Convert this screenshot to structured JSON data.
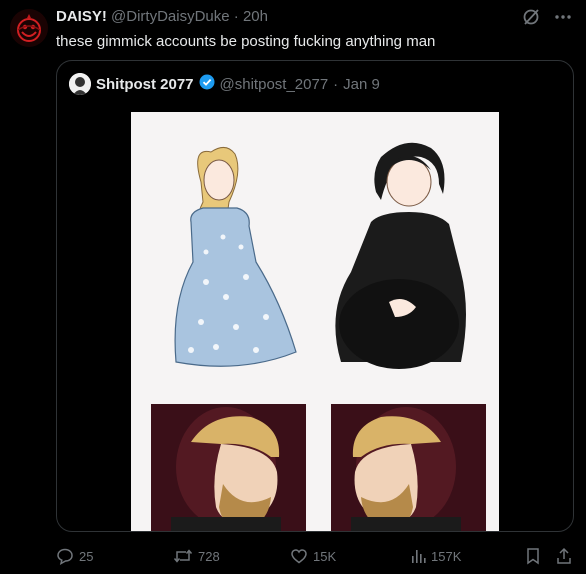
{
  "tweet": {
    "author_name": "DAISY!",
    "author_handle": "@DirtyDaisyDuke",
    "separator": "·",
    "time": "20h",
    "text": "these gimmick accounts be posting fucking anything man",
    "avatar_icon": "smiling-face-avatar",
    "more_icon": "more-dots-icon",
    "grok_icon": "grok-icon"
  },
  "quote": {
    "author_name": "Shitpost 2077",
    "verified_icon": "verified-badge-icon",
    "author_handle": "@shitpost_2077",
    "separator": "·",
    "date": "Jan 9",
    "media": {
      "type": "image",
      "description_icons": [
        "meme-girl-blue-dress",
        "meme-girl-black-dress",
        "chad-face-left",
        "chad-face-right"
      ]
    }
  },
  "actions": {
    "replies": "25",
    "reposts": "728",
    "likes": "15K",
    "views": "157K"
  },
  "colors": {
    "background": "#000000",
    "text": "#e7e9ea",
    "muted": "#71767b",
    "border": "#2f3336",
    "verified": "#1d9bf0"
  }
}
